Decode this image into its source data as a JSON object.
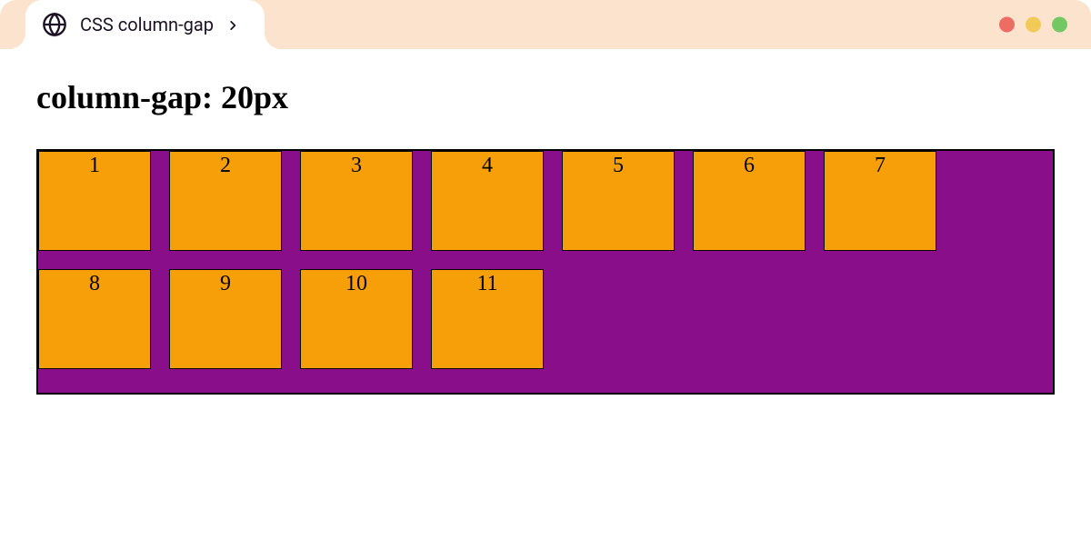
{
  "tab": {
    "label": "CSS column-gap"
  },
  "heading": "column-gap: 20px",
  "colors": {
    "container_bg": "#880e8a",
    "box_bg": "#f79f08"
  },
  "boxes": [
    "1",
    "2",
    "3",
    "4",
    "5",
    "6",
    "7",
    "8",
    "9",
    "10",
    "11"
  ]
}
